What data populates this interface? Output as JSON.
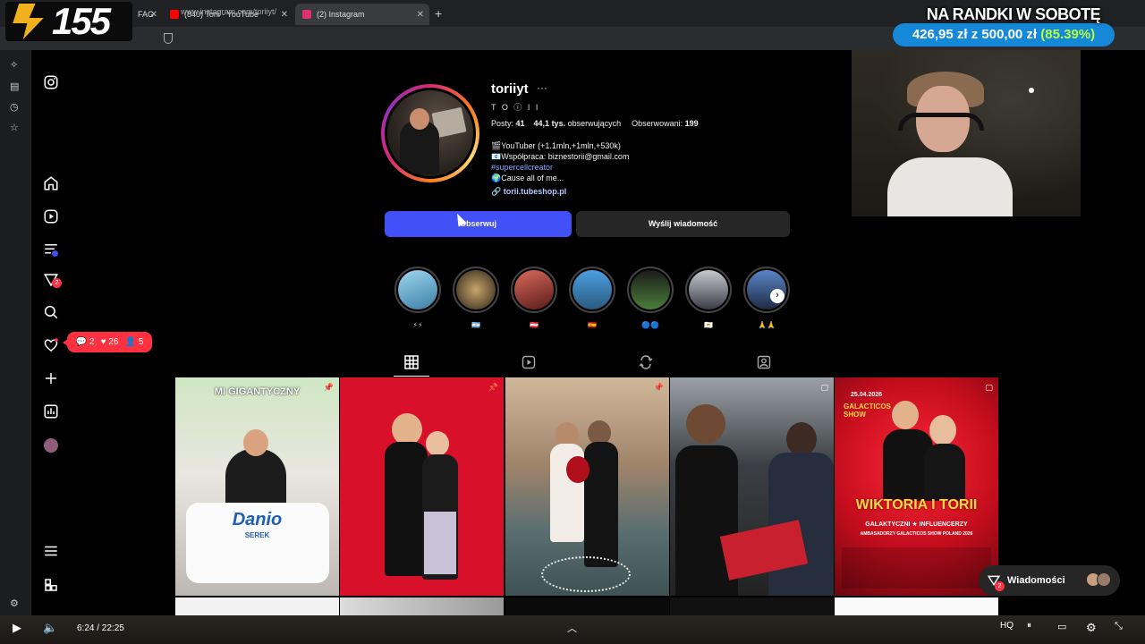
{
  "browser": {
    "tabs": [
      {
        "label": "FAG",
        "favicon_color": "#888888"
      },
      {
        "label": "(840) Torii - YouTube",
        "favicon_color": "#ff0000"
      },
      {
        "label": "(2) Instagram",
        "favicon_color": "#e1306c"
      }
    ],
    "url": "www.instagram.com/toriiyt/"
  },
  "overlay": {
    "channel_number": "155",
    "donation_title": "NA RANDKI W SOBOTĘ",
    "donation_current": "426,95 zł",
    "donation_sep": "z",
    "donation_goal": "500,00 zł",
    "donation_percent": "(85.39%)"
  },
  "instagram": {
    "sidebar": {
      "notif_pill": {
        "comments": "2",
        "likes": "26",
        "follows": "5"
      },
      "reels_badge": "2"
    },
    "profile": {
      "username": "toriiyt",
      "more": "···",
      "full_name": "T O ⓘ I I",
      "posts_label": "Posty:",
      "posts": "41",
      "followers": "44,1 tys.",
      "followers_label": "obserwujących",
      "following_label": "Obserwowani:",
      "following": "199",
      "bio": [
        "🎬YouTuber (+1.1mln,+1mln,+530k)",
        "📧Współpraca: biznestorii@gmail.com",
        "#supercellcreator",
        "🌍Cause all of me..."
      ],
      "link": "torii.tubeshop.pl",
      "follow_button": "Obserwuj",
      "message_button": "Wyślij wiadomość"
    },
    "highlights": [
      {
        "label": "⚡⚡",
        "color": "#4a8fb8"
      },
      {
        "label": "🇦🇷",
        "color": "#5a4a32"
      },
      {
        "label": "🇦🇹",
        "color": "#9a2a2a"
      },
      {
        "label": "🇪🇸",
        "color": "#2f6f9f"
      },
      {
        "label": "🔵🔵",
        "color": "#3a4a3a"
      },
      {
        "label": "🇨🇾",
        "color": "#6a6f7a"
      },
      {
        "label": "🙏🙏",
        "color": "#3a5a8a"
      }
    ],
    "posts": [
      {
        "caption": "MI GIGANTYCZNY",
        "product": "Danio",
        "product_sub": "SEREK"
      },
      {
        "caption": ""
      },
      {
        "caption": ""
      },
      {
        "caption": ""
      },
      {
        "caption": "WIKTORIA I TORII",
        "date": "25.04.2026",
        "event": "GALACTICOS SHOW",
        "sub": "GALAKTYCZNI ★ INFLUENCERZY",
        "sub2": "AMBASADORZY GALACTICOS SHOW POLAND 2026"
      }
    ],
    "messages_label": "Wiadomości",
    "messages_badge": "2"
  },
  "player": {
    "time": "6:24 / 22:25"
  }
}
